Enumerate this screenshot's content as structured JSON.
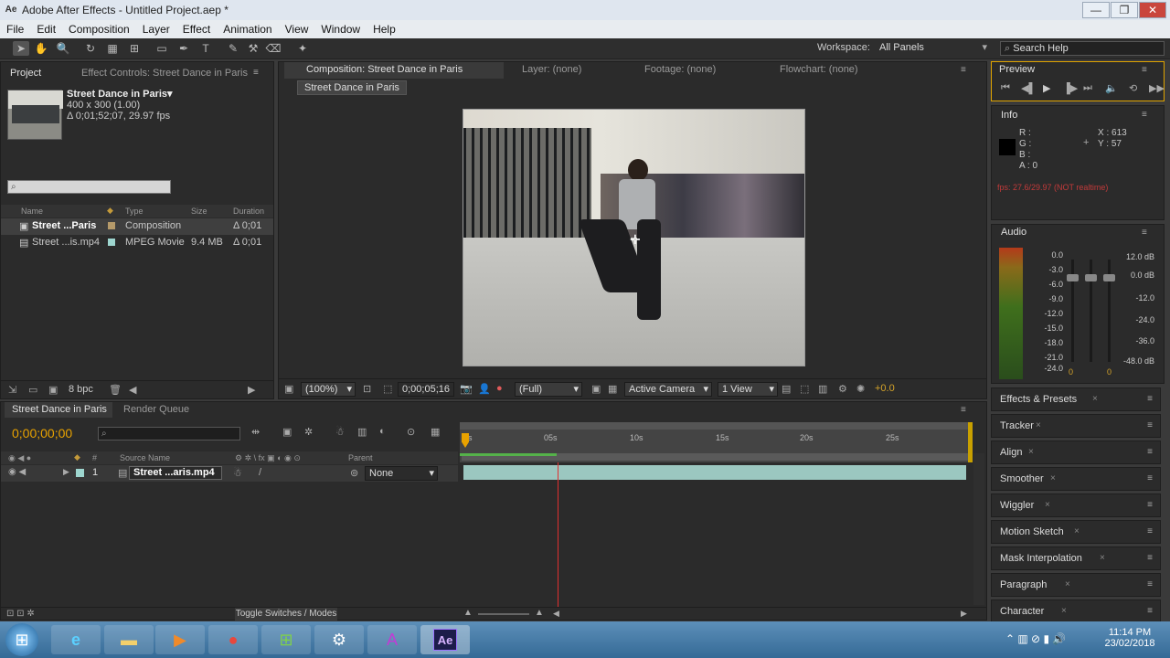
{
  "window": {
    "title": "Adobe After Effects - Untitled Project.aep *",
    "minimize": "—",
    "maximize": "❐",
    "close": "✕",
    "app_glyph": "Ae"
  },
  "menu": [
    "File",
    "Edit",
    "Composition",
    "Layer",
    "Effect",
    "Animation",
    "View",
    "Window",
    "Help"
  ],
  "toolbar": {
    "workspace_label": "Workspace:",
    "workspace_value": "All Panels",
    "search_placeholder": "Search Help"
  },
  "project": {
    "tab": "Project",
    "effect_tab": "Effect Controls: Street Dance in Paris",
    "item_name": "Street Dance in Paris▾",
    "item_size": "400 x 300 (1.00)",
    "item_dur": "Δ 0;01;52;07, 29.97 fps",
    "columns": {
      "name": "Name",
      "type": "Type",
      "size": "Size",
      "duration": "Duration"
    },
    "rows": [
      {
        "name": "Street ...Paris",
        "type": "Composition",
        "size": "",
        "duration": "Δ 0;01"
      },
      {
        "name": "Street ...is.mp4",
        "type": "MPEG Movie",
        "size": "9.4 MB",
        "duration": "Δ 0;01"
      }
    ],
    "bpc": "8 bpc"
  },
  "comp": {
    "tab": "Composition: Street Dance in Paris",
    "layer_tab": "Layer: (none)",
    "footage_tab": "Footage: (none)",
    "flowchart_tab": "Flowchart: (none)",
    "crumb": "Street Dance in Paris",
    "zoom": "(100%)",
    "timecode": "0;00;05;16",
    "resolution": "(Full)",
    "camera": "Active Camera",
    "views": "1 View",
    "exposure": "+0.0"
  },
  "preview": {
    "tab": "Preview"
  },
  "info": {
    "tab": "Info",
    "r": "R :",
    "g": "G :",
    "b": "B :",
    "a": "A : 0",
    "x": "X : 613",
    "y": "Y : 57",
    "warning": "fps: 27.6/29.97 (NOT realtime)"
  },
  "audio": {
    "tab": "Audio",
    "left_db": [
      "0.0",
      "-3.0",
      "-6.0",
      "-9.0",
      "-12.0",
      "-15.0",
      "-18.0",
      "-21.0",
      "-24.0"
    ],
    "right_db": [
      "12.0 dB",
      "0.0 dB",
      "-12.0",
      "-24.0",
      "-36.0",
      "-48.0 dB"
    ],
    "fader_l": "0",
    "fader_r": "0"
  },
  "sidepanels": [
    "Effects & Presets",
    "Tracker",
    "Align",
    "Smoother",
    "Wiggler",
    "Motion Sketch",
    "Mask Interpolation",
    "Paragraph",
    "Character"
  ],
  "timeline": {
    "tab": "Street Dance in Paris",
    "render_tab": "Render Queue",
    "timecode": "0;00;00;00",
    "col_source": "Source Name",
    "col_parent": "Parent",
    "layer_num": "1",
    "layer_name": "Street ...aris.mp4",
    "parent_value": "None",
    "ruler": [
      "0s",
      "05s",
      "10s",
      "15s",
      "20s",
      "25s"
    ],
    "toggle_label": "Toggle Switches / Modes"
  },
  "taskbar": {
    "time": "11:14 PM",
    "date": "23/02/2018",
    "ae": "Ae"
  },
  "colors": {
    "accent": "#f0a500",
    "timecode": "#e8a200",
    "playhead": "#e03030",
    "layerbar": "#9bc7c0",
    "workarea": "#55b24a"
  }
}
